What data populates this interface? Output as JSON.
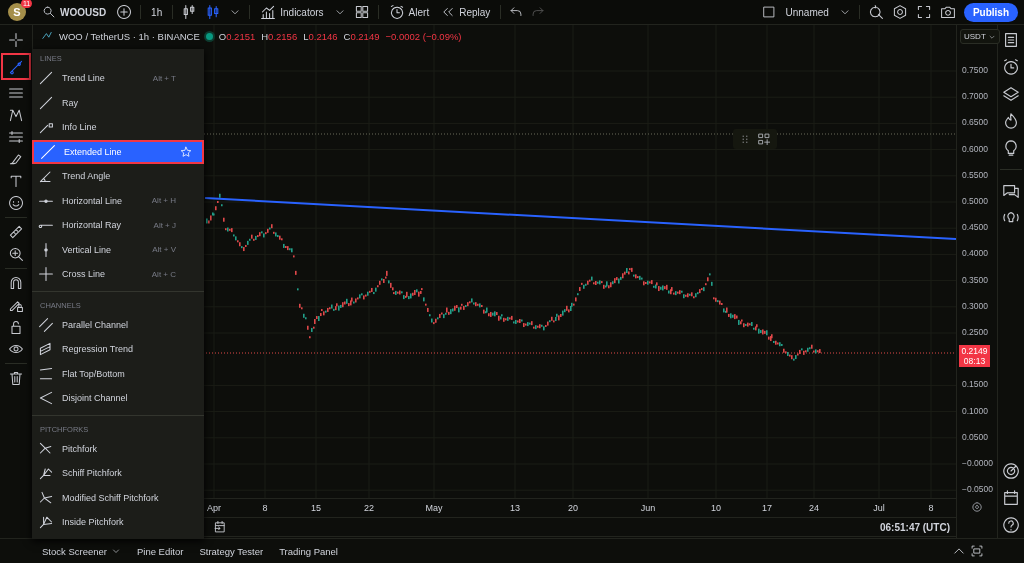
{
  "top_bar": {
    "avatar": "S",
    "badge": "11",
    "symbol": "WOOUSD",
    "interval": "1h",
    "indicators": "Indicators",
    "alert": "Alert",
    "replay": "Replay",
    "layout_name": "Unnamed",
    "publish": "Publish"
  },
  "legend": {
    "title": "WOO / TetherUS · 1h · BINANCE",
    "ohlc": [
      {
        "label": "O",
        "value": "0.2151"
      },
      {
        "label": "H",
        "value": "0.2156"
      },
      {
        "label": "L",
        "value": "0.2146"
      },
      {
        "label": "C",
        "value": "0.2149"
      }
    ],
    "change": "−0.0002 (−0.09%)"
  },
  "left_toolbar": [
    {
      "selected": false
    },
    {
      "selected": true
    },
    {
      "selected": false
    },
    {
      "selected": false
    },
    {
      "selected": false
    },
    {
      "selected": false
    },
    {
      "selected": false
    },
    {
      "selected": false
    },
    {
      "selected": false
    },
    {
      "selected": false
    },
    {
      "selected": false
    },
    {
      "selected": false
    },
    {
      "selected": false
    },
    {
      "selected": false
    },
    {
      "selected": false
    }
  ],
  "tools_menu": [
    {
      "title": "LINES",
      "items": [
        {
          "label": "Trend Line",
          "shortcut": "Alt + T",
          "selected": false
        },
        {
          "label": "Ray",
          "selected": false
        },
        {
          "label": "Info Line",
          "selected": false
        },
        {
          "label": "Extended Line",
          "selected": true
        },
        {
          "label": "Trend Angle",
          "selected": false
        },
        {
          "label": "Horizontal Line",
          "shortcut": "Alt + H",
          "selected": false
        },
        {
          "label": "Horizontal Ray",
          "shortcut": "Alt + J",
          "selected": false
        },
        {
          "label": "Vertical Line",
          "shortcut": "Alt + V",
          "selected": false
        },
        {
          "label": "Cross Line",
          "shortcut": "Alt + C",
          "selected": false
        }
      ]
    },
    {
      "title": "CHANNELS",
      "items": [
        {
          "label": "Parallel Channel",
          "selected": false
        },
        {
          "label": "Regression Trend",
          "selected": false
        },
        {
          "label": "Flat Top/Bottom",
          "selected": false
        },
        {
          "label": "Disjoint Channel",
          "selected": false
        }
      ]
    },
    {
      "title": "PITCHFORKS",
      "items": [
        {
          "label": "Pitchfork",
          "selected": false
        },
        {
          "label": "Schiff Pitchfork",
          "selected": false
        },
        {
          "label": "Modified Schiff Pitchfork",
          "selected": false
        },
        {
          "label": "Inside Pitchfork",
          "selected": false
        }
      ]
    }
  ],
  "price_axis": {
    "currency": "USDT",
    "labels": [
      "0.7500",
      "0.7000",
      "0.6500",
      "0.6000",
      "0.5500",
      "0.5000",
      "0.4500",
      "0.4000",
      "0.3500",
      "0.3000",
      "0.2500",
      "0.1500",
      "0.1000",
      "0.0500",
      "−0.0000",
      "−0.0500"
    ],
    "last_price": "0.2149",
    "countdown": "08:13"
  },
  "time_axis": {
    "labels": [
      "Apr",
      "8",
      "15",
      "22",
      "May",
      "13",
      "20",
      "Jun",
      "10",
      "17",
      "24",
      "Jul",
      "8"
    ],
    "clock": "06:51:47 (UTC)"
  },
  "bottom_panel": {
    "tabs": [
      {
        "label": "Stock Screener",
        "dropdown": true
      },
      {
        "label": "Pine Editor",
        "dropdown": false
      },
      {
        "label": "Strategy Tester",
        "dropdown": false
      },
      {
        "label": "Trading Panel",
        "dropdown": false
      }
    ]
  }
}
